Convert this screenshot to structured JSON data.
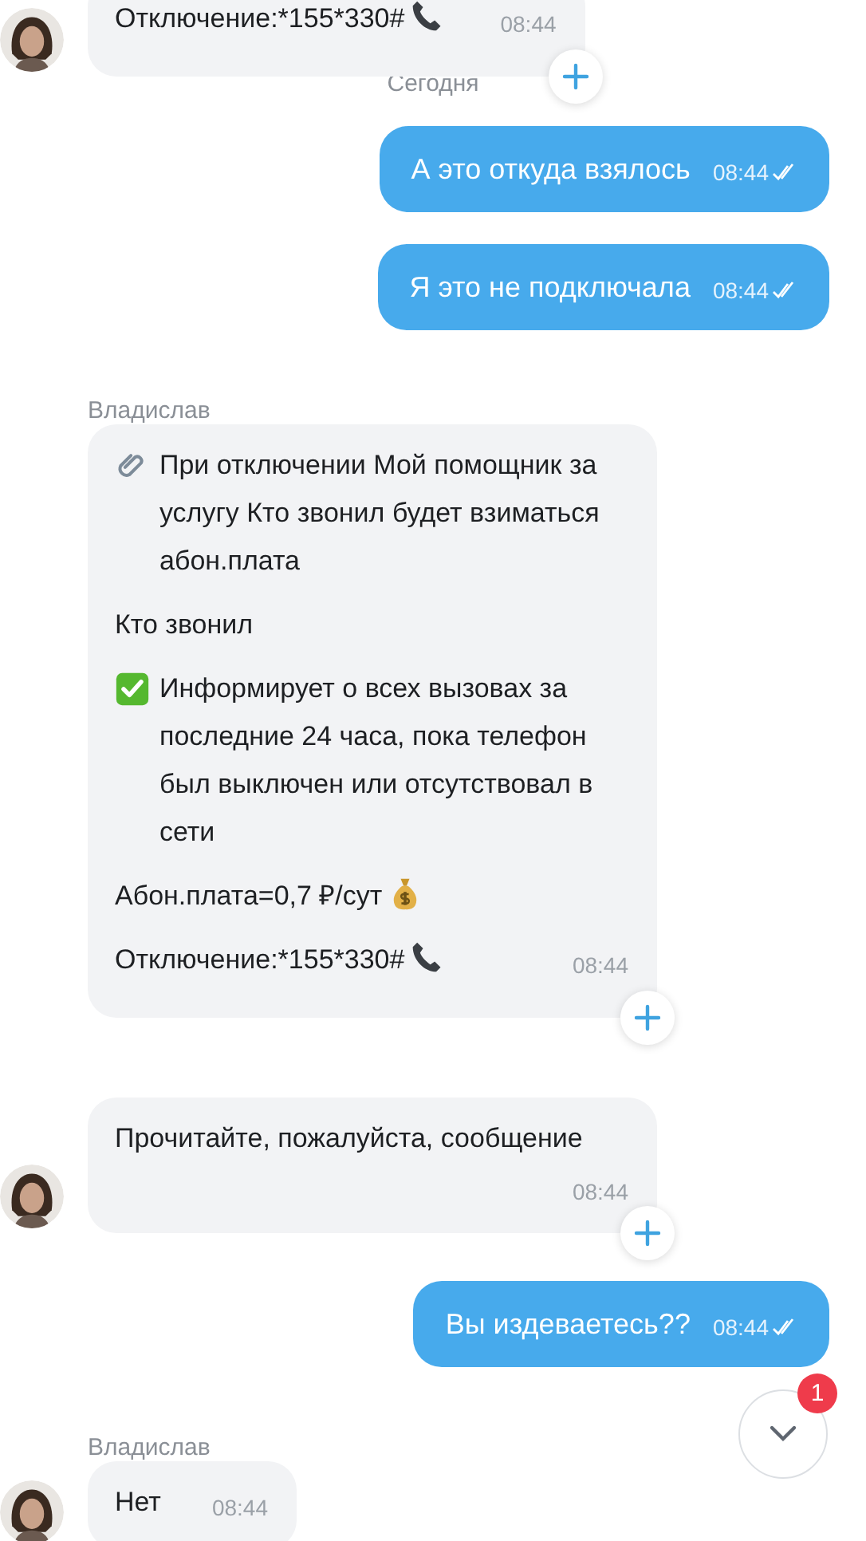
{
  "messages": [
    {
      "kind": "incoming",
      "avatar": true,
      "paragraphs": [
        {
          "text": "Отключение:*155*330#",
          "kind": "call"
        }
      ],
      "time": "08:44"
    },
    {
      "kind": "date",
      "text": "Сегодня"
    },
    {
      "kind": "outgoing",
      "text": "А это откуда взялось",
      "time": "08:44",
      "read": true
    },
    {
      "kind": "outgoing",
      "text": "Я это не подключала",
      "time": "08:44",
      "read": true
    },
    {
      "kind": "incoming",
      "author": "Владислав",
      "avatar": false,
      "paragraphs": [
        {
          "text": "При отключении Мой помощник за услугу Кто звонил будет взиматься абон.плата",
          "kind": "attachment"
        },
        {
          "text": "Кто звонил"
        },
        {
          "text": "Информирует о всех вызовах за последние 24 часа, пока телефон был выключен или отсутствовал в сети",
          "kind": "checked"
        },
        {
          "text": "Абон.плата=0,7 ₽/сут",
          "kind": "price"
        },
        {
          "text": "Отключение:*155*330#",
          "kind": "call"
        }
      ],
      "time": "08:44"
    },
    {
      "kind": "incoming",
      "avatar": true,
      "paragraphs": [
        {
          "text": "Прочитайте, пожалуйста, сообщение"
        }
      ],
      "time": "08:44"
    },
    {
      "kind": "outgoing",
      "text": "Вы издеваетесь??",
      "time": "08:44",
      "read": true
    },
    {
      "kind": "incoming",
      "author": "Владислав",
      "avatar": true,
      "paragraphs": [
        {
          "text": "Нет"
        }
      ],
      "time": "08:44"
    }
  ],
  "scroll_down": {
    "unread": "1"
  }
}
